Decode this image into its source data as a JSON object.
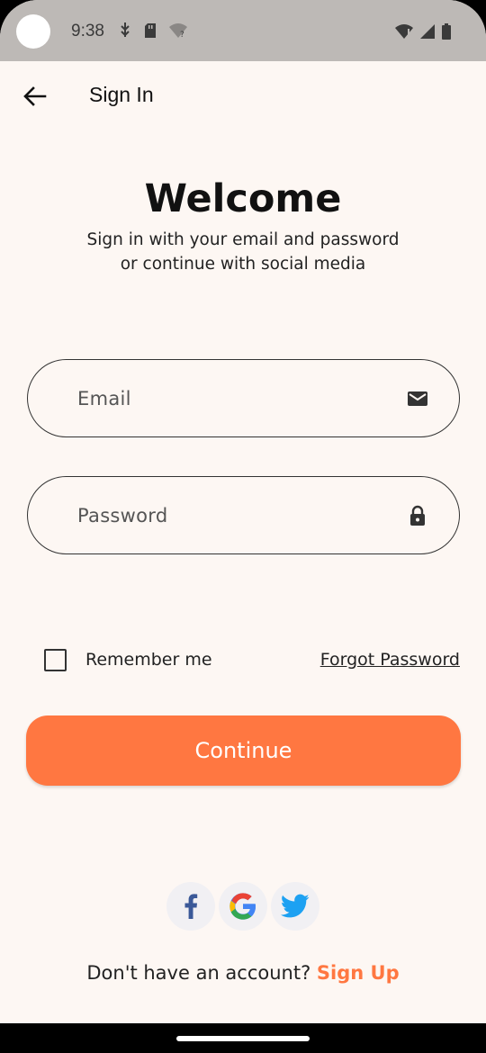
{
  "status_bar": {
    "time": "9:38",
    "left_icons": [
      "usb-debug-icon",
      "sd-card-icon",
      "wifi-question-icon"
    ],
    "right_icons": [
      "wifi-alert-icon",
      "cell-signal-icon",
      "battery-icon"
    ]
  },
  "app_bar": {
    "back_icon": "arrow-back-icon",
    "title": "Sign In"
  },
  "welcome": {
    "title": "Welcome",
    "subtitle_line1": "Sign in with your email and password",
    "subtitle_line2": "or continue with social media"
  },
  "form": {
    "email": {
      "placeholder": "Email",
      "value": "",
      "icon": "mail-icon"
    },
    "password": {
      "placeholder": "Password",
      "value": "",
      "icon": "lock-icon"
    },
    "remember_me": {
      "label": "Remember me",
      "checked": false
    },
    "forgot_password": "Forgot Password",
    "continue_label": "Continue"
  },
  "social": [
    {
      "name": "facebook",
      "icon": "facebook-icon"
    },
    {
      "name": "google",
      "icon": "google-icon"
    },
    {
      "name": "twitter",
      "icon": "twitter-icon"
    }
  ],
  "footer": {
    "prompt": "Don't have an account?",
    "signup_label": "Sign Up"
  },
  "colors": {
    "accent": "#ff7741",
    "background": "#fdf7f3",
    "status_bar": "#bdb9b6"
  }
}
